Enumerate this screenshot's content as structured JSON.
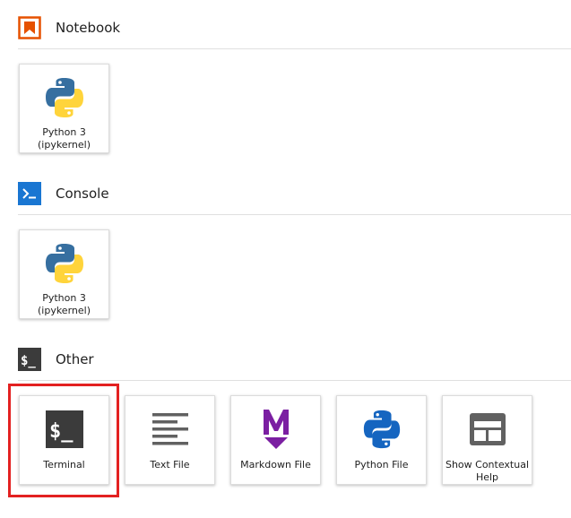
{
  "sections": {
    "notebook": {
      "title": "Notebook",
      "icon": "notebook-bookmark-icon",
      "cards": [
        {
          "label": "Python 3\n(ipykernel)",
          "icon": "python-logo-icon"
        }
      ]
    },
    "console": {
      "title": "Console",
      "icon": "console-prompt-icon",
      "cards": [
        {
          "label": "Python 3\n(ipykernel)",
          "icon": "python-logo-icon"
        }
      ]
    },
    "other": {
      "title": "Other",
      "icon": "terminal-icon",
      "cards": [
        {
          "label": "Terminal",
          "icon": "terminal-icon"
        },
        {
          "label": "Text File",
          "icon": "text-lines-icon"
        },
        {
          "label": "Markdown File",
          "icon": "markdown-icon"
        },
        {
          "label": "Python File",
          "icon": "python-logo-icon"
        },
        {
          "label": "Show Contextual\nHelp",
          "icon": "contextual-help-icon"
        }
      ]
    }
  },
  "highlight": {
    "target": "Terminal",
    "color": "#e32121"
  },
  "colors": {
    "notebook_accent": "#e65100",
    "console_accent": "#1976d2",
    "terminal_dark": "#3b3b3b",
    "markdown_purple": "#7b1fa2",
    "python_blue": "#366fa0",
    "python_yellow": "#ffd43b",
    "text_gray": "#616161"
  }
}
